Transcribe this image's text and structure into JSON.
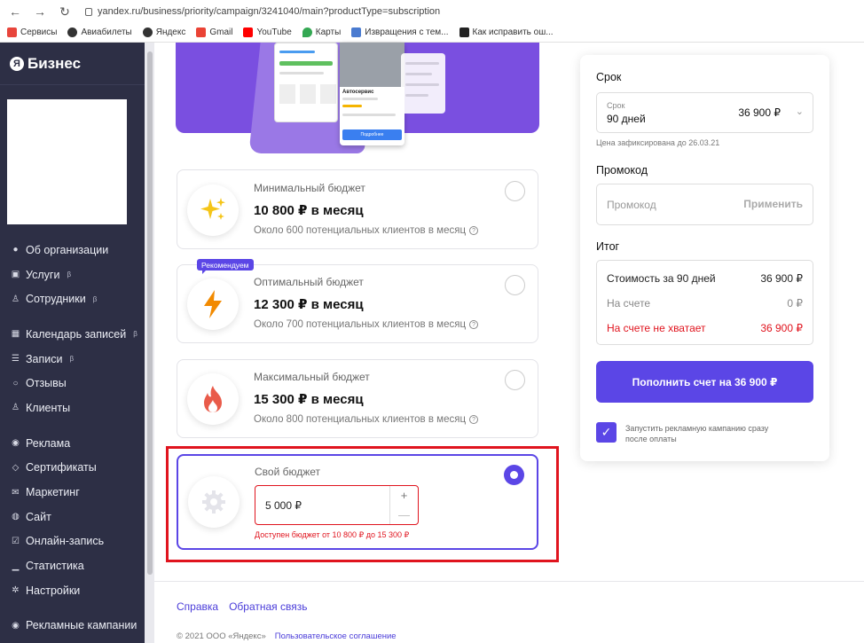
{
  "browser": {
    "url": "yandex.ru/business/priority/campaign/3241040/main?productType=subscription",
    "bookmarks": [
      "Сервисы",
      "Авиабилеты",
      "Яндекс",
      "Gmail",
      "YouTube",
      "Карты",
      "Извращения с тем...",
      "Как исправить ош..."
    ]
  },
  "sidebar": {
    "logo": "Бизнес",
    "beta": "β",
    "items": [
      {
        "label": "Об организации",
        "icon": "location-icon"
      },
      {
        "label": "Услуги",
        "icon": "services-icon",
        "beta": true
      },
      {
        "label": "Сотрудники",
        "icon": "people-icon",
        "beta": true
      },
      {
        "label": "Календарь записей",
        "icon": "calendar-icon",
        "beta": true
      },
      {
        "label": "Записи",
        "icon": "list-icon",
        "beta": true
      },
      {
        "label": "Отзывы",
        "icon": "chat-icon"
      },
      {
        "label": "Клиенты",
        "icon": "person-icon"
      },
      {
        "label": "Реклама",
        "icon": "compass-icon"
      },
      {
        "label": "Сертификаты",
        "icon": "tag-icon"
      },
      {
        "label": "Маркетинг",
        "icon": "mail-icon"
      },
      {
        "label": "Сайт",
        "icon": "globe-icon"
      },
      {
        "label": "Онлайн-запись",
        "icon": "check-icon"
      },
      {
        "label": "Статистика",
        "icon": "bars-icon"
      },
      {
        "label": "Настройки",
        "icon": "gear-icon"
      },
      {
        "label": "Рекламные кампании",
        "icon": "compass-icon"
      }
    ]
  },
  "plans": [
    {
      "title": "Минимальный бюджет",
      "price": "10 800 ₽ в месяц",
      "sub": "Около 600 потенциальных клиентов в месяц",
      "icon": "sparkles-icon"
    },
    {
      "title": "Оптимальный бюджет",
      "price": "12 300 ₽ в месяц",
      "sub": "Около 700 потенциальных клиентов в месяц",
      "icon": "lightning-icon",
      "badge": "Рекомендуем"
    },
    {
      "title": "Максимальный бюджет",
      "price": "15 300 ₽ в месяц",
      "sub": "Около 800 потенциальных клиентов в месяц",
      "icon": "flame-icon"
    }
  ],
  "own_budget": {
    "title": "Свой бюджет",
    "value": "5 000 ₽",
    "plus": "+",
    "minus": "—",
    "error": "Доступен бюджет от 10 800 ₽ до 15 300 ₽"
  },
  "mockup": {
    "title": "Автосервис",
    "button": "Подробнее"
  },
  "footer": {
    "help": "Справка",
    "feedback": "Обратная связь",
    "copyright": "© 2021 ООО «Яндекс»",
    "agreement": "Пользовательское соглашение"
  },
  "panel": {
    "term_heading": "Срок",
    "term_label": "Срок",
    "term_value": "90 дней",
    "term_price": "36 900 ₽",
    "fixed_note": "Цена зафиксирована до 26.03.21",
    "promo_heading": "Промокод",
    "promo_placeholder": "Промокод",
    "promo_apply": "Применить",
    "total_heading": "Итог",
    "rows": [
      {
        "label": "Стоимость за 90 дней",
        "value": "36 900 ₽"
      },
      {
        "label": "На счете",
        "value": "0 ₽"
      },
      {
        "label": "На счете не хватает",
        "value": "36 900 ₽"
      }
    ],
    "pay_button": "Пополнить счет на 36 900 ₽",
    "checkbox_label": "Запустить рекламную кампанию сразу после оплаты"
  },
  "colors": {
    "accent": "#5b46e6",
    "error": "#e0141e",
    "sidebar": "#2d2f45"
  }
}
